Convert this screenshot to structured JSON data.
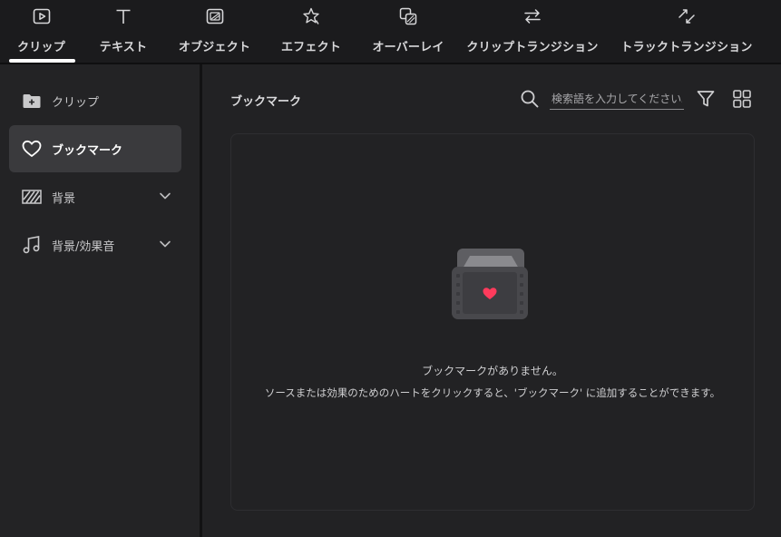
{
  "tabs": [
    {
      "label": "クリップ",
      "icon": "play-square-icon",
      "active": true
    },
    {
      "label": "テキスト",
      "icon": "text-t-icon",
      "active": false
    },
    {
      "label": "オブジェクト",
      "icon": "sticker-icon",
      "active": false
    },
    {
      "label": "エフェクト",
      "icon": "effect-star-icon",
      "active": false
    },
    {
      "label": "オーバーレイ",
      "icon": "overlay-icon",
      "active": false
    },
    {
      "label": "クリップトランジション",
      "icon": "swap-arrows-icon",
      "active": false
    },
    {
      "label": "トラックトランジション",
      "icon": "track-transition-icon",
      "active": false
    }
  ],
  "sidebar": {
    "items": [
      {
        "label": "クリップ",
        "icon": "folder-plus-icon",
        "active": false,
        "expandable": false
      },
      {
        "label": "ブックマーク",
        "icon": "heart-icon",
        "active": true,
        "expandable": false
      },
      {
        "label": "背景",
        "icon": "striped-pattern-icon",
        "active": false,
        "expandable": true
      },
      {
        "label": "背景/効果音",
        "icon": "music-note-icon",
        "active": false,
        "expandable": true
      }
    ]
  },
  "main": {
    "title": "ブックマーク",
    "search": {
      "placeholder": "検索語を入力してください。",
      "value": ""
    },
    "empty_state": {
      "title": "ブックマークがありません。",
      "description": "ソースまたは効果のためのハートをクリックすると、'ブックマーク' に追加することができます。"
    }
  },
  "colors": {
    "background": "#222224",
    "topbar": "#1b1b1d",
    "active_item": "#3a3a3d",
    "heart_accent": "#ff3b5c",
    "text": "#d4d4d6"
  }
}
